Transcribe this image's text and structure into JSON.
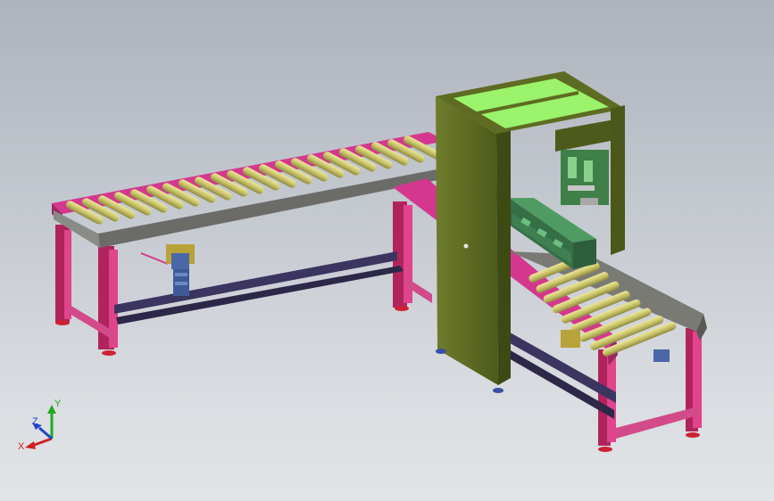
{
  "viewport": {
    "background_top": "#aeb3bc",
    "background_bottom": "#e2e4e7"
  },
  "colors": {
    "roller": "#c9c46a",
    "side_rail_magenta": "#d4388e",
    "frame_leg": "#c02a6c",
    "cabinet": "#5e6b22",
    "cabinet_top_panel": "#9af36a",
    "crate": "#3f7f52",
    "motor": "#4a67a8",
    "foot": "#cc2233",
    "cross_beam": "#3b3560"
  },
  "triad": {
    "x_label": "X",
    "y_label": "Y",
    "z_label": "Z",
    "x_color": "#cc2222",
    "y_color": "#22aa22",
    "z_color": "#2244cc"
  }
}
